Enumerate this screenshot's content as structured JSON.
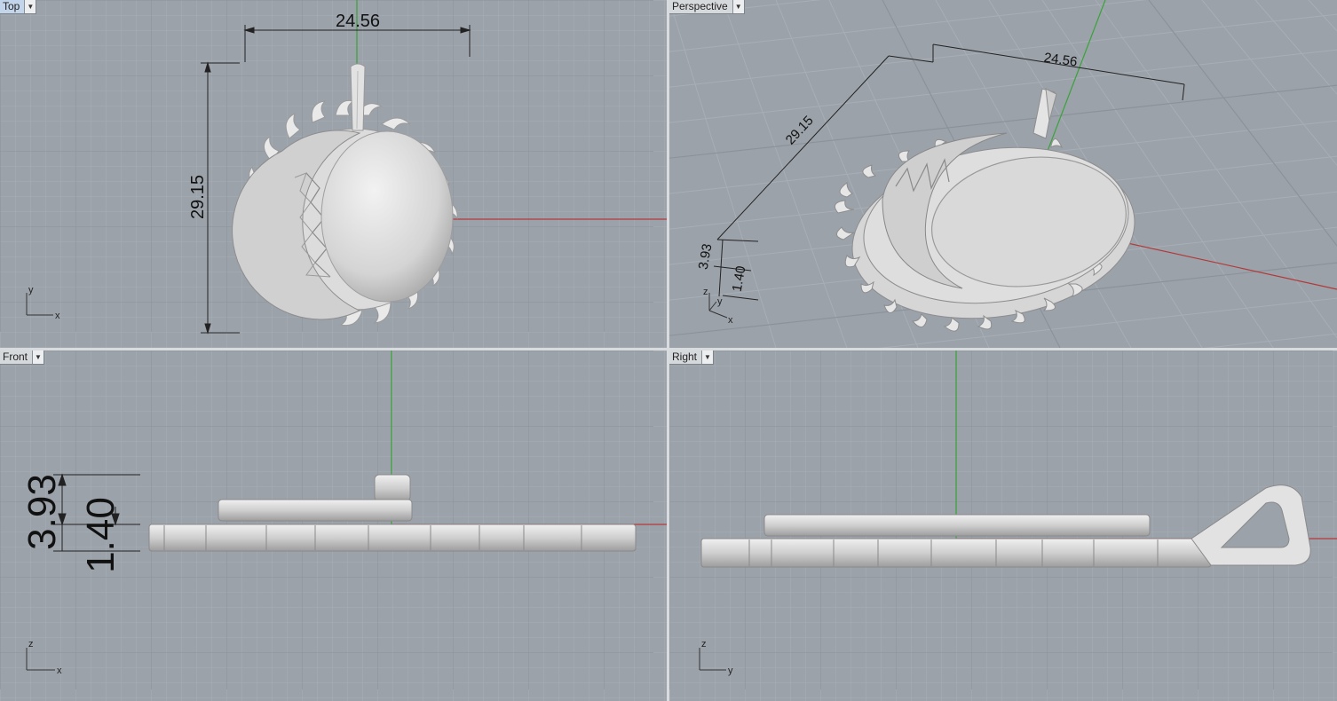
{
  "viewports": {
    "top": {
      "title": "Top",
      "dim_width": "24.56",
      "dim_height": "29.15",
      "axis_h": "x",
      "axis_v": "y"
    },
    "persp": {
      "title": "Perspective",
      "dim_width": "24.56",
      "dim_height": "29.15",
      "dim_total": "3.93",
      "dim_base": "1.40",
      "axis_x": "x",
      "axis_y": "y",
      "axis_z": "z"
    },
    "front": {
      "title": "Front",
      "dim_total": "3.93",
      "dim_base": "1.40",
      "axis_h": "x",
      "axis_v": "z"
    },
    "right": {
      "title": "Right",
      "axis_h": "y",
      "axis_v": "z"
    }
  },
  "colors": {
    "x_axis": "#b23a3a",
    "y_axis": "#3aa33a",
    "grid_minor": "#a9afb6",
    "grid_major": "#8a9199",
    "viewport_bg": "#9ba2aa"
  },
  "icons": {
    "dropdown": "chevron-down-icon"
  }
}
